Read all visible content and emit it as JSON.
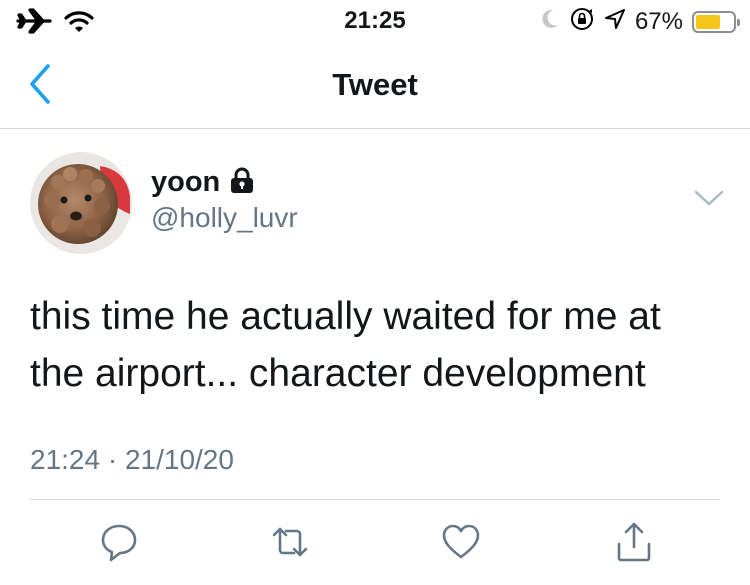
{
  "status_bar": {
    "time": "21:25",
    "battery_percent": "67%",
    "battery_level": 0.67,
    "icons": [
      "airplane-icon",
      "wifi-icon",
      "moon-icon",
      "orientation-lock-icon",
      "location-icon",
      "battery-icon"
    ],
    "battery_color": "#f5c518"
  },
  "nav": {
    "title": "Tweet",
    "back_icon": "chevron-left-icon",
    "accent_color": "#1da1f2"
  },
  "tweet": {
    "display_name": "yoon",
    "protected_icon": "lock-icon",
    "handle": "@holly_luvr",
    "text": "this time he actually waited for me at the airport... character development",
    "timestamp": "21:24 · 21/10/20",
    "menu_icon": "chevron-down-icon"
  },
  "actions": [
    "reply-icon",
    "retweet-icon",
    "like-icon",
    "share-icon"
  ]
}
